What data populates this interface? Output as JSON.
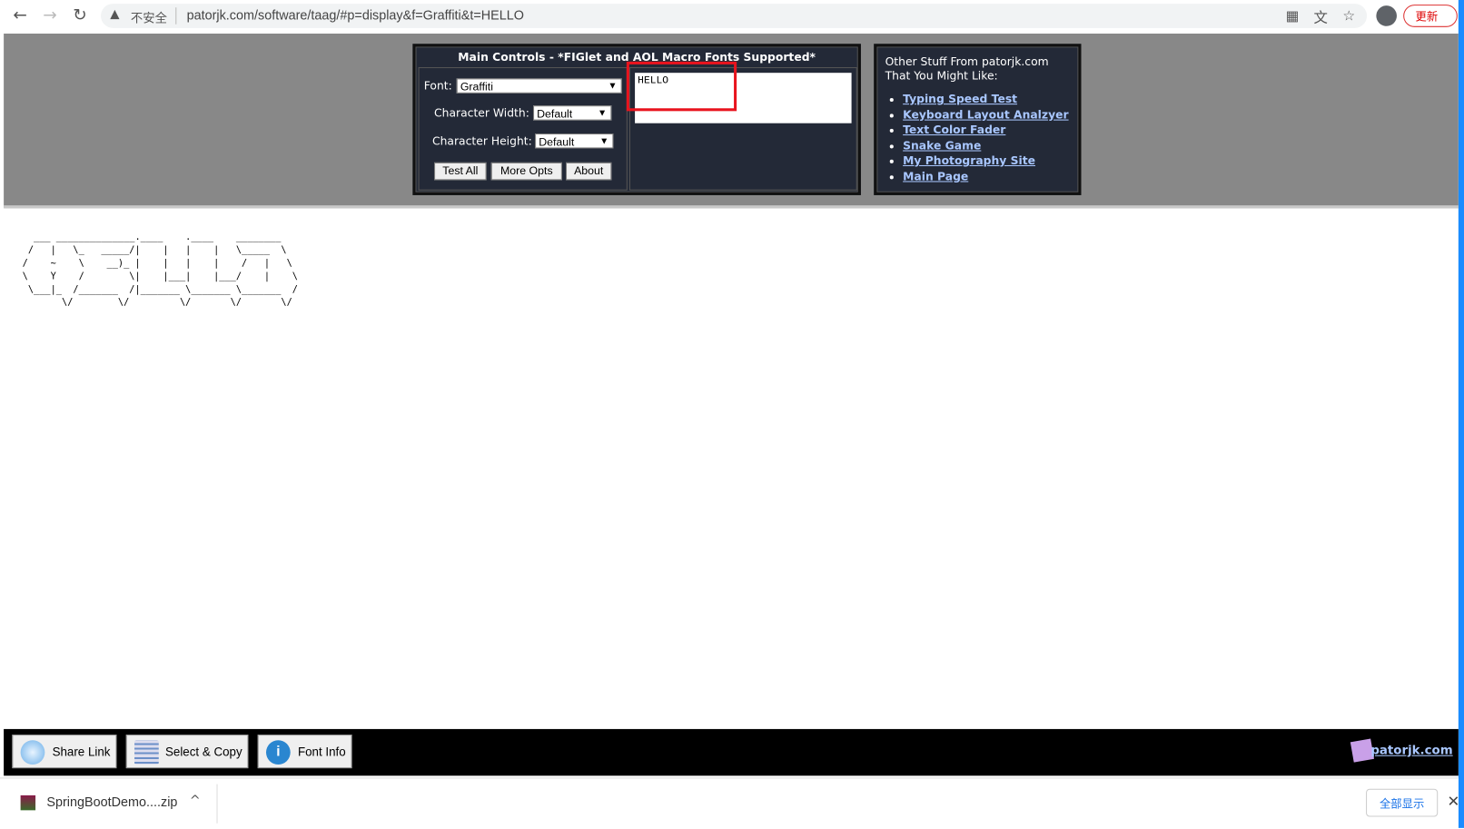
{
  "browser": {
    "security_label": "不安全",
    "url": "patorjk.com/software/taag/#p=display&f=Graffiti&t=HELLO",
    "update_label": "更新"
  },
  "main_controls": {
    "title": "Main Controls - *FIGlet and AOL Macro Fonts Supported*",
    "font_label": "Font:",
    "font_value": "Graffiti",
    "char_width_label": "Character Width:",
    "char_width_value": "Default",
    "char_height_label": "Character Height:",
    "char_height_value": "Default",
    "buttons": [
      "Test All",
      "More Opts",
      "About"
    ],
    "input_text": "HELLO"
  },
  "other_stuff": {
    "heading_line1": "Other Stuff From patorjk.com",
    "heading_line2": "That You Might Like:",
    "links": [
      "Typing Speed Test",
      "Keyboard Layout Analzyer",
      "Text Color Fader",
      "Snake Game",
      "My Photography Site",
      "Main Page"
    ]
  },
  "output_art": "  ___ ______________.____    .____    ________   \n /   |   \\_   _____/|    |   |    |   \\_____  \\  \n/    ~    \\    __)_ |    |   |    |    /   |   \\ \n\\    Y    /        \\|    |___|    |___/    |    \\\n \\___|_  /_______  /|_______ \\_______ \\_______  /\n       \\/        \\/         \\/       \\/       \\/ ",
  "footer": {
    "share_label": "Share Link",
    "copy_label": "Select & Copy",
    "info_label": "Font Info",
    "brand": "patorjk.com"
  },
  "download_bar": {
    "file_name": "SpringBootDemo....zip",
    "show_all_label": "全部显示"
  },
  "colors": {
    "panel": "#232937",
    "link": "#a9c7ff",
    "highlight": "#e8141e"
  }
}
